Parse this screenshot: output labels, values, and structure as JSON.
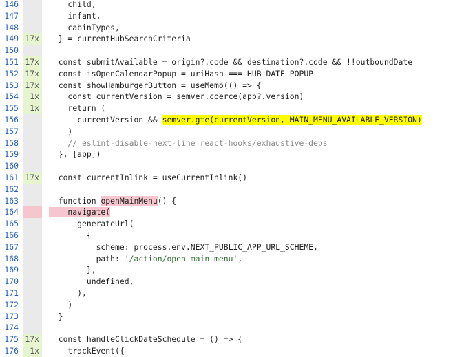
{
  "lines": [
    {
      "n": "146",
      "cov": "",
      "covClass": "",
      "code": "    child,"
    },
    {
      "n": "147",
      "cov": "",
      "covClass": "",
      "code": "    infant,"
    },
    {
      "n": "148",
      "cov": "",
      "covClass": "",
      "code": "    cabinTypes,"
    },
    {
      "n": "149",
      "cov": "17x",
      "covClass": "hit",
      "code": "  } = currentHubSearchCriteria"
    },
    {
      "n": "150",
      "cov": "",
      "covClass": "",
      "code": ""
    },
    {
      "n": "151",
      "cov": "17x",
      "covClass": "hit",
      "code": "  const submitAvailable = origin?.code && destination?.code && !!outboundDate"
    },
    {
      "n": "152",
      "cov": "17x",
      "covClass": "hit",
      "code": "  const isOpenCalendarPopup = uriHash === HUB_DATE_POPUP"
    },
    {
      "n": "153",
      "cov": "17x",
      "covClass": "hit",
      "code": "  const showHamburgerButton = useMemo(() => {"
    },
    {
      "n": "154",
      "cov": "1x",
      "covClass": "hit",
      "code": "    const currentVersion = semver.coerce(app?.version)"
    },
    {
      "n": "155",
      "cov": "1x",
      "covClass": "hit",
      "code": "    return ("
    },
    {
      "n": "156",
      "cov": "",
      "covClass": "",
      "code": "      currentVersion && ",
      "hl": "semver.gte(currentVersion, MAIN_MENU_AVAILABLE_VERSION)"
    },
    {
      "n": "157",
      "cov": "",
      "covClass": "",
      "code": "    )"
    },
    {
      "n": "158",
      "cov": "",
      "covClass": "",
      "code": "    // eslint-disable-next-line react-hooks/exhaustive-deps",
      "comment": true
    },
    {
      "n": "159",
      "cov": "",
      "covClass": "",
      "code": "  }, [app])"
    },
    {
      "n": "160",
      "cov": "",
      "covClass": "",
      "code": ""
    },
    {
      "n": "161",
      "cov": "17x",
      "covClass": "hit",
      "code": "  const currentInlink = useCurrentInlink()"
    },
    {
      "n": "162",
      "cov": "",
      "covClass": "",
      "code": ""
    },
    {
      "n": "163",
      "cov": "",
      "covClass": "",
      "code": "  function ",
      "redhl": "openMainMenu",
      "after": "() {"
    },
    {
      "n": "164",
      "cov": "",
      "covClass": "miss",
      "code": "    navigate(",
      "missline": true
    },
    {
      "n": "165",
      "cov": "",
      "covClass": "",
      "code": "      generateUrl("
    },
    {
      "n": "166",
      "cov": "",
      "covClass": "",
      "code": "        {"
    },
    {
      "n": "167",
      "cov": "",
      "covClass": "",
      "code": "          scheme: process.env.NEXT_PUBLIC_APP_URL_SCHEME,"
    },
    {
      "n": "168",
      "cov": "",
      "covClass": "",
      "code": "          path: ",
      "str": "'/action/open_main_menu'",
      "after": ","
    },
    {
      "n": "169",
      "cov": "",
      "covClass": "",
      "code": "        },"
    },
    {
      "n": "170",
      "cov": "",
      "covClass": "",
      "code": "        undefined,"
    },
    {
      "n": "171",
      "cov": "",
      "covClass": "",
      "code": "      ),"
    },
    {
      "n": "172",
      "cov": "",
      "covClass": "",
      "code": "    )"
    },
    {
      "n": "173",
      "cov": "",
      "covClass": "",
      "code": "  }"
    },
    {
      "n": "174",
      "cov": "",
      "covClass": "",
      "code": ""
    },
    {
      "n": "175",
      "cov": "17x",
      "covClass": "hit",
      "code": "  const handleClickDateSchedule = () => {"
    },
    {
      "n": "176",
      "cov": "1x",
      "covClass": "hit",
      "code": "    trackEvent({"
    }
  ]
}
